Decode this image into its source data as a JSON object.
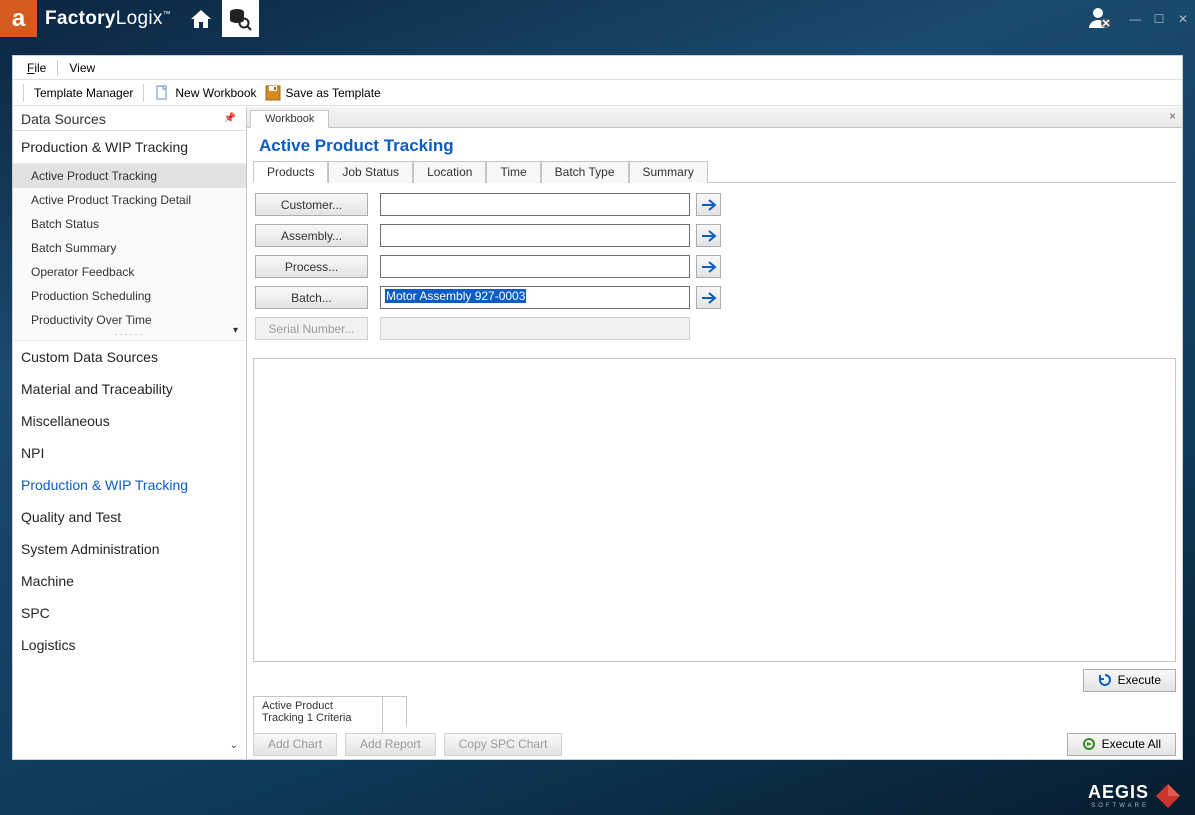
{
  "brand": {
    "name_bold": "Factory",
    "name_light": "Logix",
    "tm": "™"
  },
  "menu": {
    "file": "File",
    "view": "View"
  },
  "toolbar": {
    "template_manager": "Template Manager",
    "new_workbook": "New Workbook",
    "save_template": "Save as Template"
  },
  "sidebar": {
    "title": "Data Sources",
    "expanded": "Production & WIP Tracking",
    "items": [
      "Active Product Tracking",
      "Active Product Tracking Detail",
      "Batch Status",
      "Batch Summary",
      "Operator Feedback",
      "Production Scheduling",
      "Productivity Over Time"
    ],
    "categories": [
      "Custom Data Sources",
      "Material and Traceability",
      "Miscellaneous",
      "NPI",
      "Production & WIP Tracking",
      "Quality and Test",
      "System Administration",
      "Machine",
      "SPC",
      "Logistics"
    ]
  },
  "tab": {
    "workbook": "Workbook"
  },
  "page": {
    "title": "Active Product Tracking"
  },
  "subtabs": [
    "Products",
    "Job Status",
    "Location",
    "Time",
    "Batch Type",
    "Summary"
  ],
  "form": {
    "customer": {
      "label": "Customer...",
      "value": ""
    },
    "assembly": {
      "label": "Assembly...",
      "value": ""
    },
    "process": {
      "label": "Process...",
      "value": ""
    },
    "batch": {
      "label": "Batch...",
      "value": "Motor Assembly 927-0003"
    },
    "serial": {
      "label": "Serial Number...",
      "value": ""
    }
  },
  "exec": {
    "execute": "Execute",
    "execute_all": "Execute All"
  },
  "criteria": {
    "label": "Active Product Tracking 1 Criteria"
  },
  "bottom": {
    "add_chart": "Add Chart",
    "add_report": "Add Report",
    "copy_spc": "Copy SPC Chart"
  },
  "footer": {
    "name": "AEGIS",
    "sub": "SOFTWARE"
  }
}
